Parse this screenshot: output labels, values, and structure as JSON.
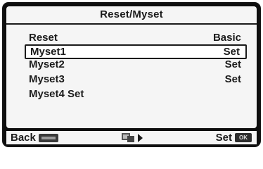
{
  "title": "Reset/Myset",
  "items": [
    {
      "label": "Reset",
      "value": "Basic"
    },
    {
      "label": "Myset1",
      "value": "Set",
      "selected": true
    },
    {
      "label": "Myset2",
      "value": "Set"
    },
    {
      "label": "Myset3",
      "value": "Set"
    },
    {
      "label": "Myset4 Set",
      "value": ""
    }
  ],
  "footer": {
    "back_label": "Back",
    "back_icon": "menu-button-icon",
    "mid_icon": "mode-icon",
    "set_label": "Set",
    "ok_label": "OK"
  },
  "colors": {
    "bezel": "#0e0e0e",
    "screen": "#f5f5f5",
    "text": "#1b1b1b"
  }
}
